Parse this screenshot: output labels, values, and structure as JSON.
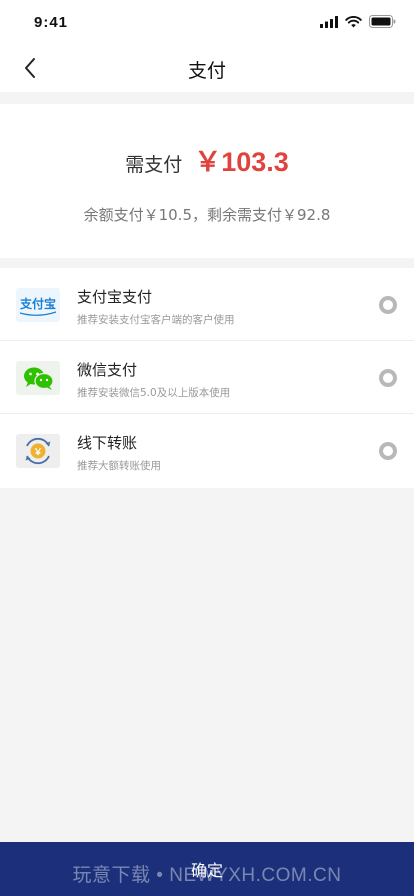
{
  "status_bar": {
    "time": "9:41"
  },
  "header": {
    "title": "支付"
  },
  "payment": {
    "amount_label": "需支付",
    "amount_value": "￥103.3",
    "detail": "余额支付￥10.5，剩余需支付￥92.8"
  },
  "methods": [
    {
      "name": "支付宝支付",
      "desc": "推荐安装支付宝客户端的客户使用",
      "icon": "alipay-icon",
      "icon_text": "支付宝",
      "selected": false
    },
    {
      "name": "微信支付",
      "desc": "推荐安装微信5.0及以上版本使用",
      "icon": "wechat-icon",
      "selected": false
    },
    {
      "name": "线下转账",
      "desc": "推荐大额转账使用",
      "icon": "bank-transfer-icon",
      "icon_text": "￥",
      "selected": false
    }
  ],
  "footer": {
    "confirm_label": "确定"
  },
  "watermark": "玩意下载 • NEWYXH.COM.CN",
  "colors": {
    "accent_red": "#e0433e",
    "confirm_bar": "#1b2f7a",
    "wechat_green": "#2dc100",
    "alipay_blue": "#1a7fd4"
  }
}
